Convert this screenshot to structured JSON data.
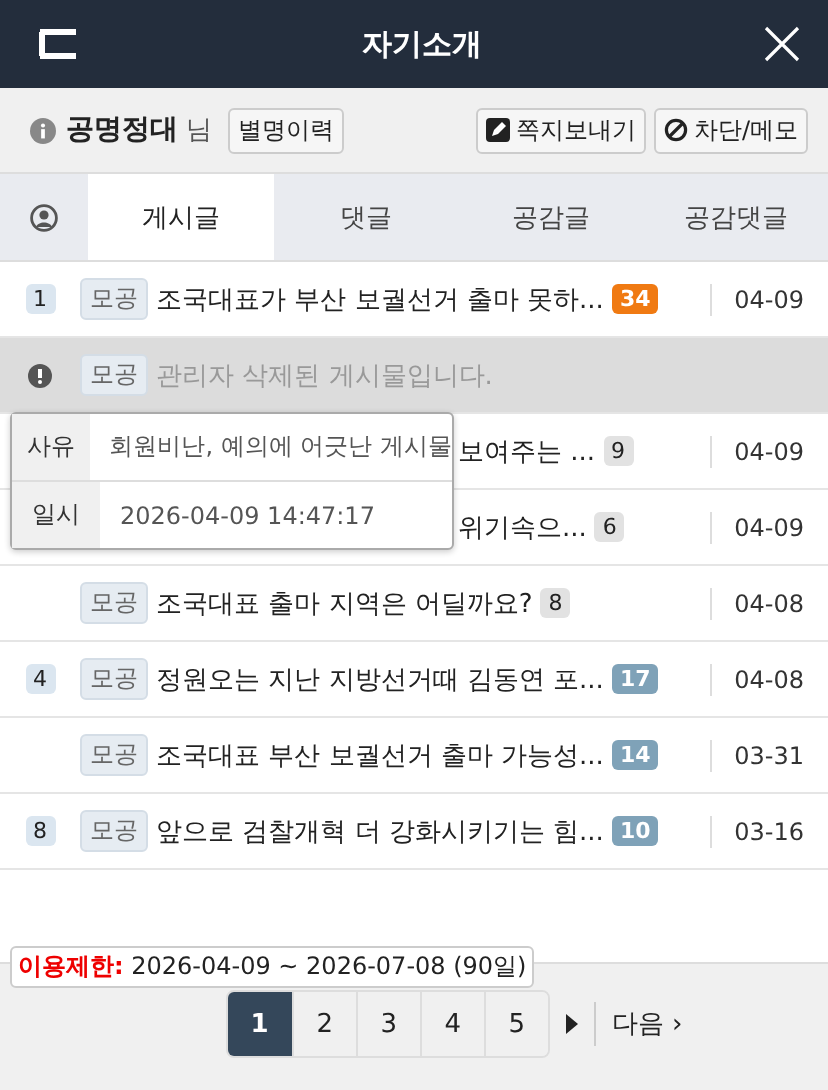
{
  "header": {
    "title": "자기소개"
  },
  "profile": {
    "nickname": "공명정대",
    "suffix": "님",
    "buttons": [
      "별명이력"
    ],
    "actions": [
      {
        "label": "쪽지보내기",
        "kind": "message"
      },
      {
        "label": "차단/메모",
        "kind": "block"
      }
    ]
  },
  "tabs": [
    {
      "label": "게시글",
      "selected": true
    },
    {
      "label": "댓글",
      "selected": false
    },
    {
      "label": "공감글",
      "selected": false
    },
    {
      "label": "공감댓글",
      "selected": false
    }
  ],
  "rows": [
    {
      "kind": "post",
      "rank": "1",
      "tag": "모공",
      "title": "조국대표가 부산 보궐선거 출마 못하...",
      "count": {
        "text": "34",
        "kind": "hot"
      },
      "date": "04-09"
    },
    {
      "kind": "deleted",
      "tag": "모공",
      "title": "관리자 삭제된 게시물입니다."
    },
    {
      "kind": "covered",
      "title": "보여주는 ...",
      "count": {
        "text": "9",
        "kind": "plain"
      },
      "date": "04-09"
    },
    {
      "kind": "covered",
      "title": "위기속으...",
      "count": {
        "text": "6",
        "kind": "plain"
      },
      "date": "04-09"
    },
    {
      "kind": "post",
      "tag": "모공",
      "title": "조국대표 출마 지역은 어딜까요?",
      "count": {
        "text": "8",
        "kind": "plain"
      },
      "date": "04-08"
    },
    {
      "kind": "post",
      "rank": "4",
      "tag": "모공",
      "title": "정원오는 지난 지방선거때 김동연 포...",
      "count": {
        "text": "17",
        "kind": "read"
      },
      "date": "04-08"
    },
    {
      "kind": "post",
      "tag": "모공",
      "title": "조국대표 부산 보궐선거 출마 가능성...",
      "count": {
        "text": "14",
        "kind": "read"
      },
      "date": "03-31"
    },
    {
      "kind": "post",
      "rank": "8",
      "tag": "모공",
      "title": "앞으로 검찰개혁 더 강화시키기는 힘...",
      "count": {
        "text": "10",
        "kind": "read"
      },
      "date": "03-16"
    }
  ],
  "popup": [
    {
      "label": "사유",
      "value": "회원비난, 예의에 어긋난 게시물"
    },
    {
      "label": "일시",
      "value": "2026-04-09 14:47:17"
    }
  ],
  "restriction": {
    "label": "이용제한:",
    "value": "2026-04-09 ~ 2026-07-08 (90일)"
  },
  "pagination": {
    "pages": [
      {
        "label": "1",
        "selected": true
      },
      {
        "label": "2",
        "selected": false
      },
      {
        "label": "3",
        "selected": false
      },
      {
        "label": "4",
        "selected": false
      },
      {
        "label": "5",
        "selected": false
      }
    ],
    "next": "다음 ›"
  }
}
